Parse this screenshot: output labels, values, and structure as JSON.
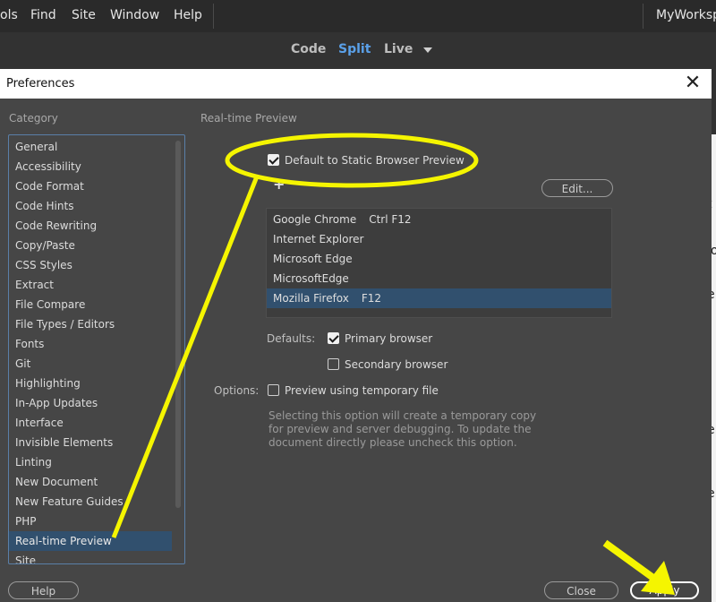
{
  "menubar": {
    "items": [
      "ols",
      "Find",
      "Site",
      "Window",
      "Help"
    ],
    "workspace": "MyWorksp"
  },
  "viewbar": {
    "modes": [
      "Code",
      "Split",
      "Live"
    ],
    "active": "Split"
  },
  "background_doc": [
    "t",
    "lo",
    "e",
    "e",
    "e"
  ],
  "dialog": {
    "title": "Preferences",
    "close_glyph": "✕",
    "category_label": "Category",
    "categories": [
      "General",
      "Accessibility",
      "Code Format",
      "Code Hints",
      "Code Rewriting",
      "Copy/Paste",
      "CSS Styles",
      "Extract",
      "File Compare",
      "File Types / Editors",
      "Fonts",
      "Git",
      "Highlighting",
      "In-App Updates",
      "Interface",
      "Invisible Elements",
      "Linting",
      "New Document",
      "New Feature Guides",
      "PHP",
      "Real-time Preview",
      "Site"
    ],
    "selected_category": "Real-time Preview",
    "section_title": "Real-time Preview",
    "default_static_label": "Default to Static Browser Preview",
    "default_static_checked": true,
    "add_glyph": "+",
    "remove_glyph": "−",
    "edit_button": "Edit...",
    "browsers": [
      {
        "name": "Google Chrome",
        "shortcut": "Ctrl F12"
      },
      {
        "name": "Internet Explorer",
        "shortcut": ""
      },
      {
        "name": "Microsoft Edge",
        "shortcut": ""
      },
      {
        "name": "MicrosoftEdge",
        "shortcut": ""
      },
      {
        "name": "Mozilla Firefox",
        "shortcut": "F12"
      }
    ],
    "selected_browser": "Mozilla Firefox",
    "defaults_label": "Defaults:",
    "primary_browser_label": "Primary browser",
    "primary_browser_checked": true,
    "secondary_browser_label": "Secondary browser",
    "secondary_browser_checked": false,
    "options_label": "Options:",
    "temp_file_label": "Preview using temporary file",
    "temp_file_checked": false,
    "note": "Selecting this option will create a temporary copy for preview and server debugging. To update the document directly please uncheck this option.",
    "help_button": "Help",
    "close_button": "Close",
    "apply_button": "Apply"
  },
  "colors": {
    "annotation": "#f5f500",
    "selection": "#31506e",
    "active_mode": "#5aa0e8"
  }
}
